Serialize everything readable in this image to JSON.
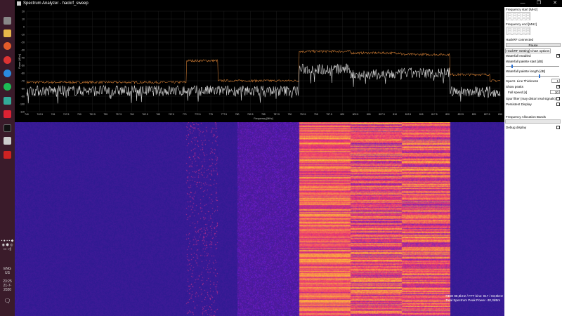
{
  "window": {
    "title": "Spectrum Analyzer - hackrf_sweep",
    "min": "—",
    "max": "❐",
    "close": "✕"
  },
  "tray": {
    "lang1": "ENG",
    "lang2": "US",
    "time": "23:25",
    "date": "21-7-2020"
  },
  "panel": {
    "freq_start_label": "Frequency start [MHz]",
    "freq_end_label": "Frequency end [MHz]",
    "status": "HackRF connected",
    "pause_label": "Pause",
    "tabs": [
      "HackRF Settings",
      "Chart options"
    ],
    "waterfall_enabled": "Waterfall enabled",
    "palette_start": "Waterfall palette start [dB]",
    "palette_length": "Waterfall palette length [dB]",
    "line_thickness": "Spectr. Line Thickness",
    "line_thickness_value": "1",
    "show_peaks": "Show peaks",
    "fall_speed": "Fall speed [s]",
    "fall_speed_value": "30",
    "spur_filter": "Spur filter (may distort real signals)",
    "persistent": "Persistent Display",
    "allocation": "Frequency Allocation Bands",
    "debug": "Debug display",
    "palette_start_fraction": 0.1,
    "palette_length_fraction": 0.62
  },
  "overlay": {
    "line1": "RBW 98,8kHz / FFT bins: 917 / 83,8kHz",
    "line2": "Total Spectrum Peak Power -30,3dBm"
  },
  "chart_data": {
    "type": "line",
    "xlabel": "Frequency [MHz]",
    "ylabel": "Power [dBm]",
    "xlim": [
      740,
      830
    ],
    "ylim": [
      -110,
      20
    ],
    "xticks": [
      "740",
      "742.5",
      "745",
      "747.5",
      "750",
      "752.5",
      "755",
      "757.5",
      "760",
      "762.5",
      "765",
      "767.5",
      "770",
      "772.5",
      "775",
      "777.5",
      "780",
      "782.5",
      "785",
      "787.5",
      "790",
      "792.5",
      "795",
      "797.5",
      "800",
      "802.5",
      "805",
      "807.5",
      "810",
      "812.5",
      "815",
      "817.5",
      "820",
      "822.5",
      "825",
      "827.5",
      "830"
    ],
    "yticks": [
      "20",
      "10",
      "0",
      "-10",
      "-20",
      "-30",
      "-40",
      "-50",
      "-60",
      "-70",
      "-80",
      "-90",
      "-100",
      "-110"
    ],
    "series": [
      {
        "name": "peak",
        "color": "#c87832",
        "bands": [
          [
            740,
            770.3,
            -72
          ],
          [
            770.3,
            776.3,
            -44
          ],
          [
            776.3,
            791.7,
            -70
          ],
          [
            791.7,
            801.5,
            -32
          ],
          [
            801.5,
            811.2,
            -34
          ],
          [
            811.2,
            820.4,
            -36
          ],
          [
            820.4,
            828,
            -62
          ],
          [
            828,
            830,
            -70
          ]
        ]
      },
      {
        "name": "realtime",
        "color": "#d8d8d8",
        "bands": [
          [
            740,
            791.7,
            -83
          ],
          [
            791.7,
            801.5,
            -55
          ],
          [
            801.5,
            811.2,
            -62
          ],
          [
            811.2,
            820.4,
            -60
          ],
          [
            820.4,
            830,
            -84
          ]
        ]
      }
    ]
  }
}
